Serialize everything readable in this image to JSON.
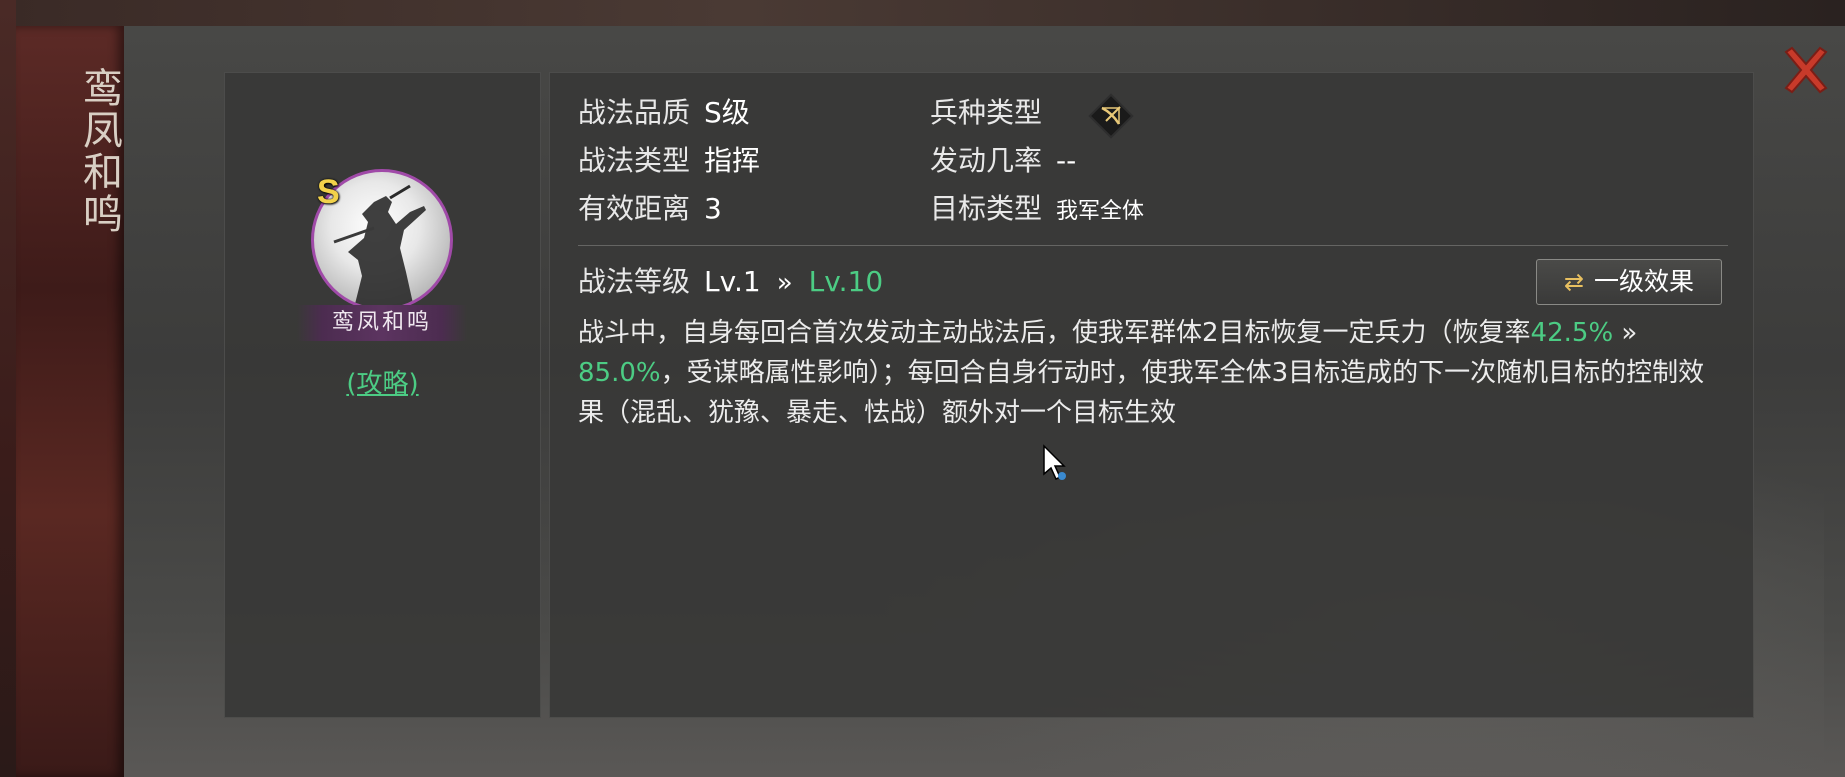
{
  "skill": {
    "name": "鸾凤和鸣",
    "grade": "S",
    "guide_link": "(攻略)"
  },
  "info": {
    "quality_label": "战法品质",
    "quality_value": "S级",
    "type_label": "战法类型",
    "type_value": "指挥",
    "range_label": "有效距离",
    "range_value": "3",
    "troop_label": "兵种类型",
    "troop_icon": "bow-troop-icon",
    "rate_label": "发动几率",
    "rate_value": "--",
    "target_label": "目标类型",
    "target_value": "我军全体"
  },
  "level": {
    "label": "战法等级",
    "current": "Lv.1",
    "arrow": "»",
    "max": "Lv.10"
  },
  "effect_button": {
    "label": "一级效果",
    "icon": "swap-icon"
  },
  "description": {
    "part1": "战斗中，自身每回合首次发动主动战法后，使我军群体2目标恢复一定兵力（恢复率",
    "rate_min": "42.5%",
    "arrow": " » ",
    "rate_max": "85.0%",
    "part2": "，受谋略属性影响）；每回合自身行动时，使我军全体3目标造成的下一次随机目标的控制效果（混乱、犹豫、暴走、怯战）额外对一个目标生效"
  },
  "colors": {
    "accent_green": "#4ccc84",
    "grade_gold": "#f2d24a",
    "close_red": "#c83a2a",
    "portrait_border": "#a04aa8"
  }
}
